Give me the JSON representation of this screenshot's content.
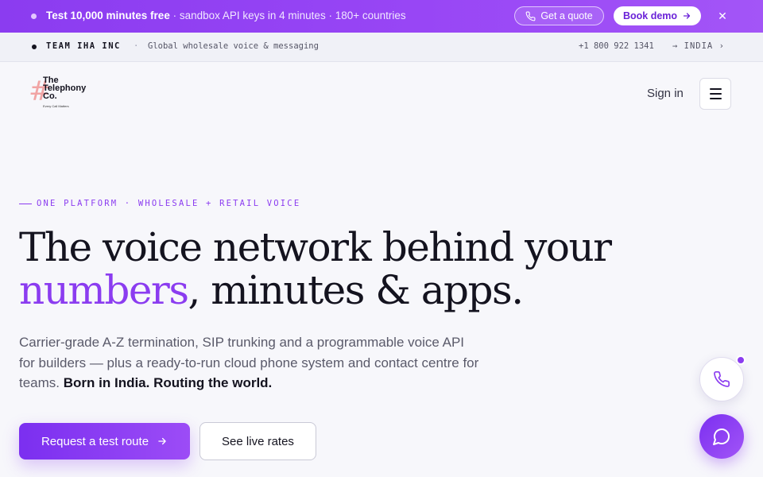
{
  "promo": {
    "headline": "Test 10,000 minutes free",
    "detail": "· sandbox API keys in 4 minutes · 180+ countries",
    "quote_label": "Get a quote",
    "demo_label": "Book demo",
    "close_glyph": "✕"
  },
  "strip": {
    "company": "TEAM IHA INC",
    "separator": "·",
    "tagline": "Global wholesale voice & messaging",
    "phone": "+1 800 922 1341",
    "region": "→ INDIA ›"
  },
  "logo": {
    "mark": "#",
    "name_line1": "The",
    "name_line2": "Telephony",
    "name_line3": "Co.",
    "slogan": "Every Call Matters"
  },
  "nav": {
    "signin_label": "Sign in"
  },
  "hero": {
    "eyebrow": "ONE PLATFORM · WHOLESALE + RETAIL VOICE",
    "headline_line1": "The voice network behind your",
    "headline_accent": "numbers",
    "headline_rest": ", minutes & apps.",
    "lede": "Carrier-grade A-Z termination, SIP trunking and a programmable voice API for builders — plus a ready-to-run cloud phone system and contact centre for teams. ",
    "lede_bold": "Born in India. Routing the world.",
    "cta_primary": "Request a test route",
    "cta_secondary": "See live rates"
  },
  "colors": {
    "accent": "#8b3cf0",
    "ink": "#14131f"
  }
}
